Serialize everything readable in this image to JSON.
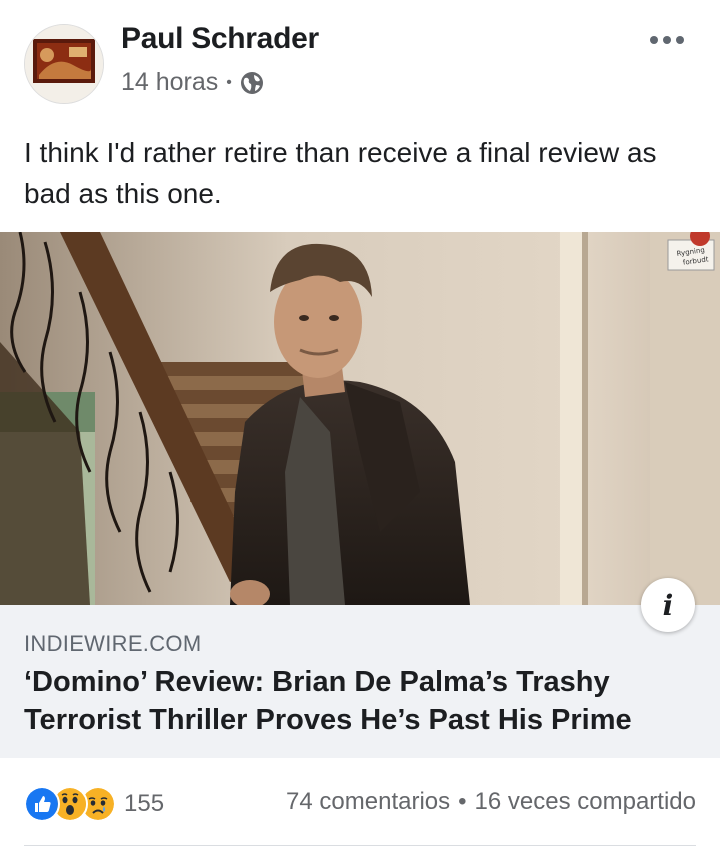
{
  "post": {
    "author": "Paul Schrader",
    "time": "14 horas",
    "separator": "•",
    "audience_icon": "globe-icon",
    "more_icon": "more-options-icon",
    "text": "I think I'd rather retire than receive a final review as bad as this one."
  },
  "link_preview": {
    "domain": "INDIEWIRE.COM",
    "headline": "‘Domino’ Review: Brian De Palma’s Trashy Terrorist Thriller Proves He’s Past His Prime",
    "info_label": "i",
    "photo_sign_text": "Rygning forbudt"
  },
  "footer": {
    "reaction_icons": [
      "like-icon",
      "wow-icon",
      "sad-icon"
    ],
    "reaction_count": "155",
    "comments": "74 comentarios",
    "separator": "•",
    "shares": "16 veces compartido"
  },
  "colors": {
    "text_primary": "#1c1e21",
    "text_secondary": "#65676b",
    "link_box_bg": "#f0f2f5",
    "like_blue": "#1877f2",
    "emoji_yellow": "#f7b125"
  }
}
